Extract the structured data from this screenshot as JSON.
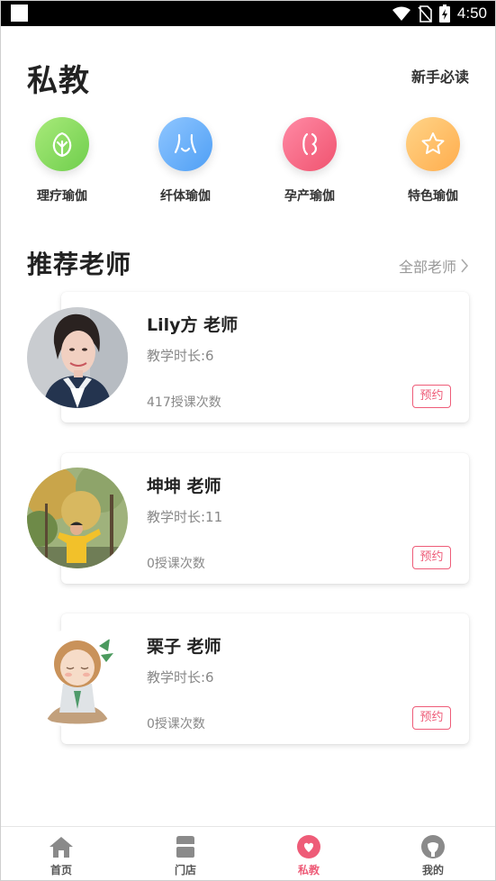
{
  "status_bar": {
    "time": "4:50"
  },
  "header": {
    "title": "私教",
    "guide_link": "新手必读"
  },
  "categories": [
    {
      "label": "理疗瑜伽",
      "icon": "leaf-icon",
      "color": "#7bd456"
    },
    {
      "label": "纤体瑜伽",
      "icon": "body-icon",
      "color": "#5aa8f7"
    },
    {
      "label": "孕产瑜伽",
      "icon": "pregnancy-icon",
      "color": "#f4607b"
    },
    {
      "label": "特色瑜伽",
      "icon": "star-icon",
      "color": "#ffb65a"
    }
  ],
  "section": {
    "title": "推荐老师",
    "all_link": "全部老师"
  },
  "teachers": [
    {
      "name": "Lily方 老师",
      "years": "教学时长:6",
      "count": "417授课次数",
      "book": "预约"
    },
    {
      "name": "坤坤 老师",
      "years": "教学时长:11",
      "count": "0授课次数",
      "book": "预约"
    },
    {
      "name": "栗子 老师",
      "years": "教学时长:6",
      "count": "0授课次数",
      "book": "预约"
    }
  ],
  "bottom_nav": [
    {
      "label": "首页",
      "icon": "home-icon",
      "active": false
    },
    {
      "label": "门店",
      "icon": "store-icon",
      "active": false
    },
    {
      "label": "私教",
      "icon": "heart-icon",
      "active": true
    },
    {
      "label": "我的",
      "icon": "profile-icon",
      "active": false
    }
  ],
  "colors": {
    "accent": "#ee5c78",
    "text_secondary": "#888888"
  }
}
